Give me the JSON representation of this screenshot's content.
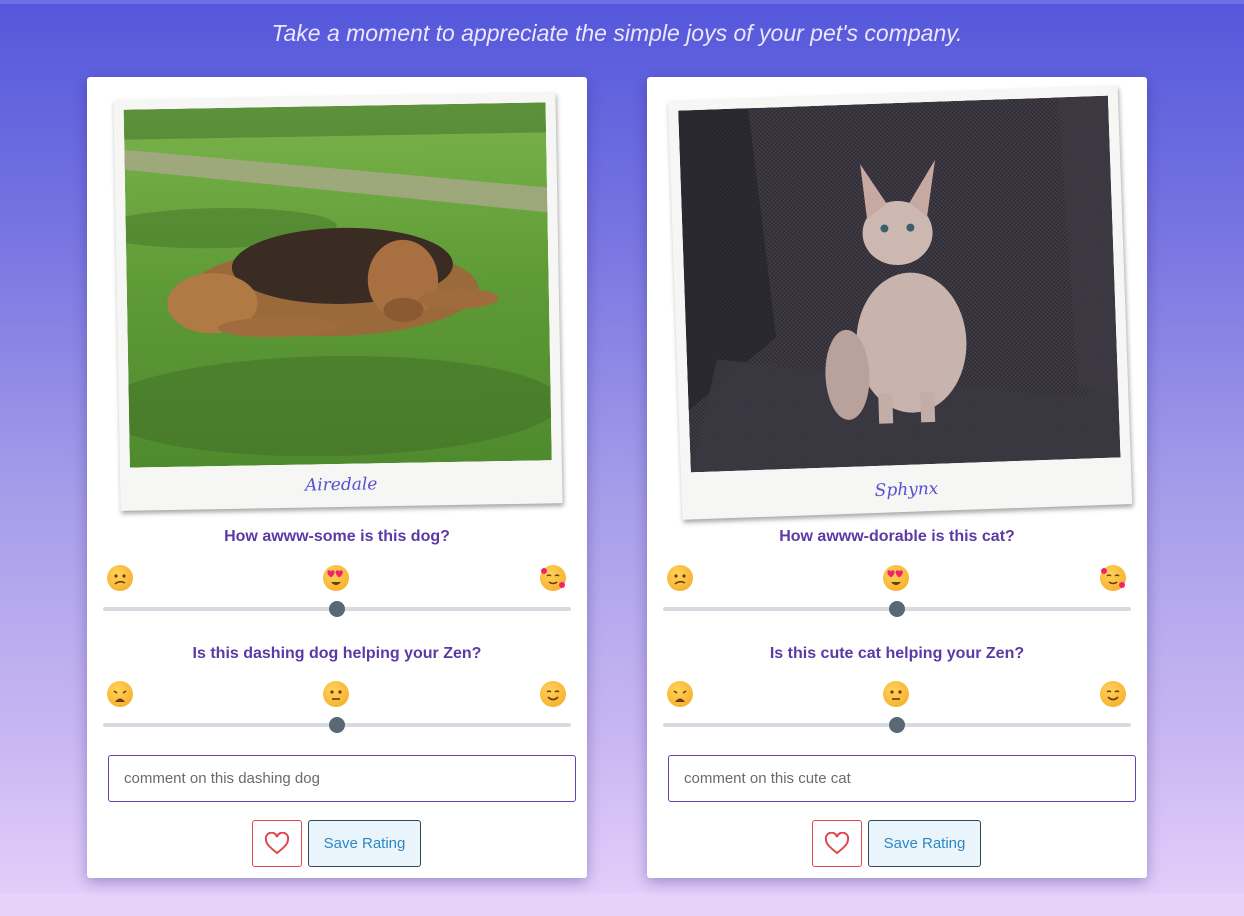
{
  "tagline": "Take a moment to appreciate the simple joys of your pet's company.",
  "cards": [
    {
      "caption": "Airedale",
      "rating_question": "How awww-some is this dog?",
      "rating_icons": [
        "confused-face-icon",
        "heart-eyes-face-icon",
        "smiling-face-with-hearts-icon"
      ],
      "rating_value": 0.5,
      "zen_question": "Is this dashing dog helping your Zen?",
      "zen_icons": [
        "weary-face-icon",
        "neutral-face-icon",
        "smiling-face-icon"
      ],
      "zen_value": 0.5,
      "comment_placeholder": "comment on this dashing dog",
      "save_label": "Save Rating"
    },
    {
      "caption": "Sphynx",
      "rating_question": "How awww-dorable is this cat?",
      "rating_icons": [
        "confused-face-icon",
        "heart-eyes-face-icon",
        "smiling-face-with-hearts-icon"
      ],
      "rating_value": 0.5,
      "zen_question": "Is this cute cat helping your Zen?",
      "zen_icons": [
        "weary-face-icon",
        "neutral-face-icon",
        "smiling-face-icon"
      ],
      "zen_value": 0.5,
      "comment_placeholder": "comment on this cute cat",
      "save_label": "Save Rating"
    }
  ],
  "colors": {
    "accent_purple": "#5b3aa6",
    "caption": "#5a4fd0",
    "heart": "#e0464b",
    "save_text": "#2e86c8",
    "slider_thumb": "#586874"
  }
}
